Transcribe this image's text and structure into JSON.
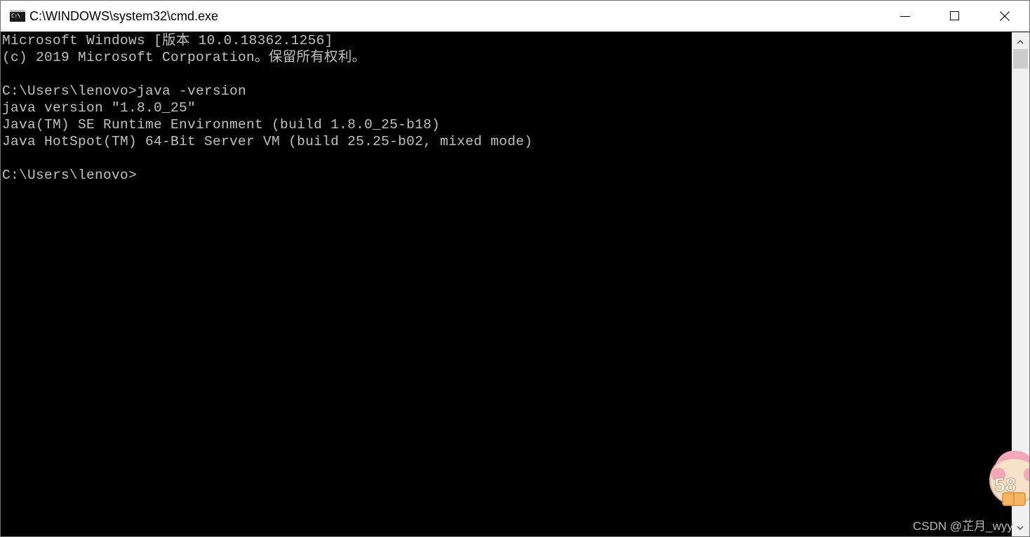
{
  "window": {
    "title": "C:\\WINDOWS\\system32\\cmd.exe",
    "icon": "cmd-icon",
    "icon_glyph": "C:\\",
    "buttons": {
      "minimize": "minimize-icon",
      "maximize": "maximize-icon",
      "close": "close-icon"
    }
  },
  "console": {
    "lines": [
      "Microsoft Windows [版本 10.0.18362.1256]",
      "(c) 2019 Microsoft Corporation。保留所有权利。",
      "",
      "C:\\Users\\lenovo>java -version",
      "java version \"1.8.0_25\"",
      "Java(TM) SE Runtime Environment (build 1.8.0_25-b18)",
      "Java HotSpot(TM) 64-Bit Server VM (build 25.25-b02, mixed mode)",
      "",
      "C:\\Users\\lenovo>"
    ],
    "text_color": "#c0c0c0",
    "background": "#000000"
  },
  "overlay": {
    "badge_text": "58",
    "watermark": "CSDN @芷月_wyy"
  }
}
